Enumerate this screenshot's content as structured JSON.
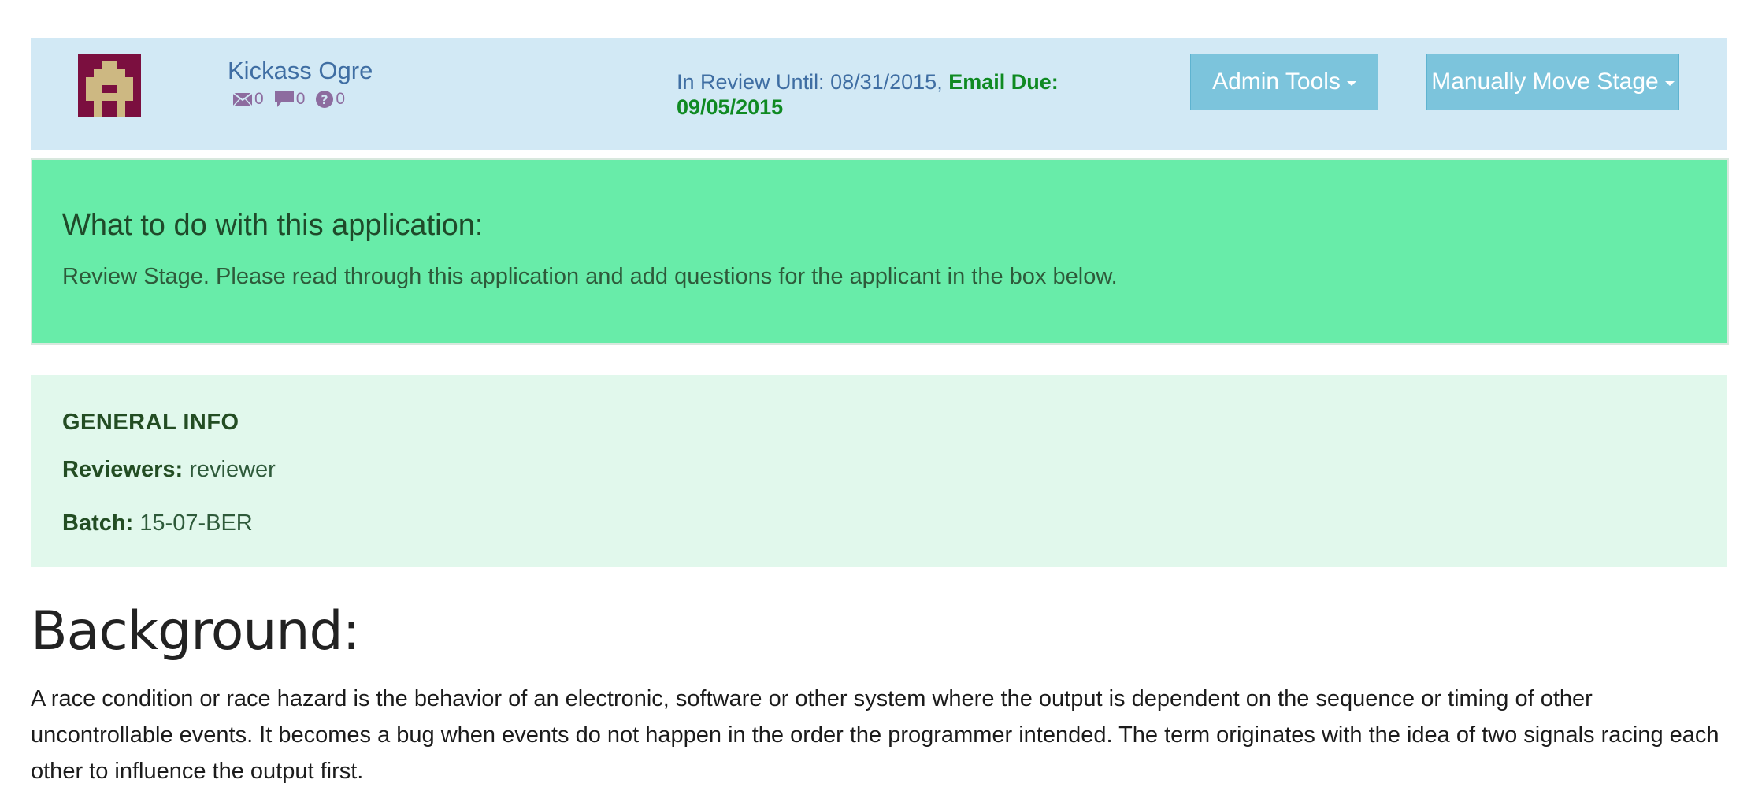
{
  "header": {
    "user_name": "Kickass Ogre",
    "counts": {
      "messages": "0",
      "comments": "0",
      "questions": "0"
    },
    "review_until": "In Review Until: 08/31/2015, ",
    "email_due_label": "Email Due:",
    "email_due_date": "09/05/2015",
    "admin_tools_label": "Admin Tools",
    "move_stage_label": "Manually Move Stage"
  },
  "instruction": {
    "title": "What to do with this application:",
    "text": "Review Stage. Please read through this application and add questions for the applicant in the box below."
  },
  "general_info": {
    "title": "GENERAL INFO",
    "reviewers_label": "Reviewers:",
    "reviewers_value": "reviewer",
    "batch_label": "Batch:",
    "batch_value": "15-07-BER"
  },
  "background": {
    "heading": "Background:",
    "text": "A race condition or race hazard is the behavior of an electronic, software or other system where the output is dependent on the sequence or timing of other uncontrollable events. It becomes a bug when events do not happen in the order the programmer intended. The term originates with the idea of two signals racing each other to influence the output first."
  },
  "colors": {
    "header_bg": "#d2e9f5",
    "button_bg": "#7cc4dc",
    "instruction_bg": "#68eca9",
    "general_bg": "#e1f8ec",
    "email_due": "#0f8a22",
    "avatar_bg": "#7b0f3f",
    "avatar_fg": "#cdb882"
  },
  "icons": [
    "avatar",
    "envelope-icon",
    "comment-icon",
    "question-icon",
    "caret-down-icon"
  ]
}
